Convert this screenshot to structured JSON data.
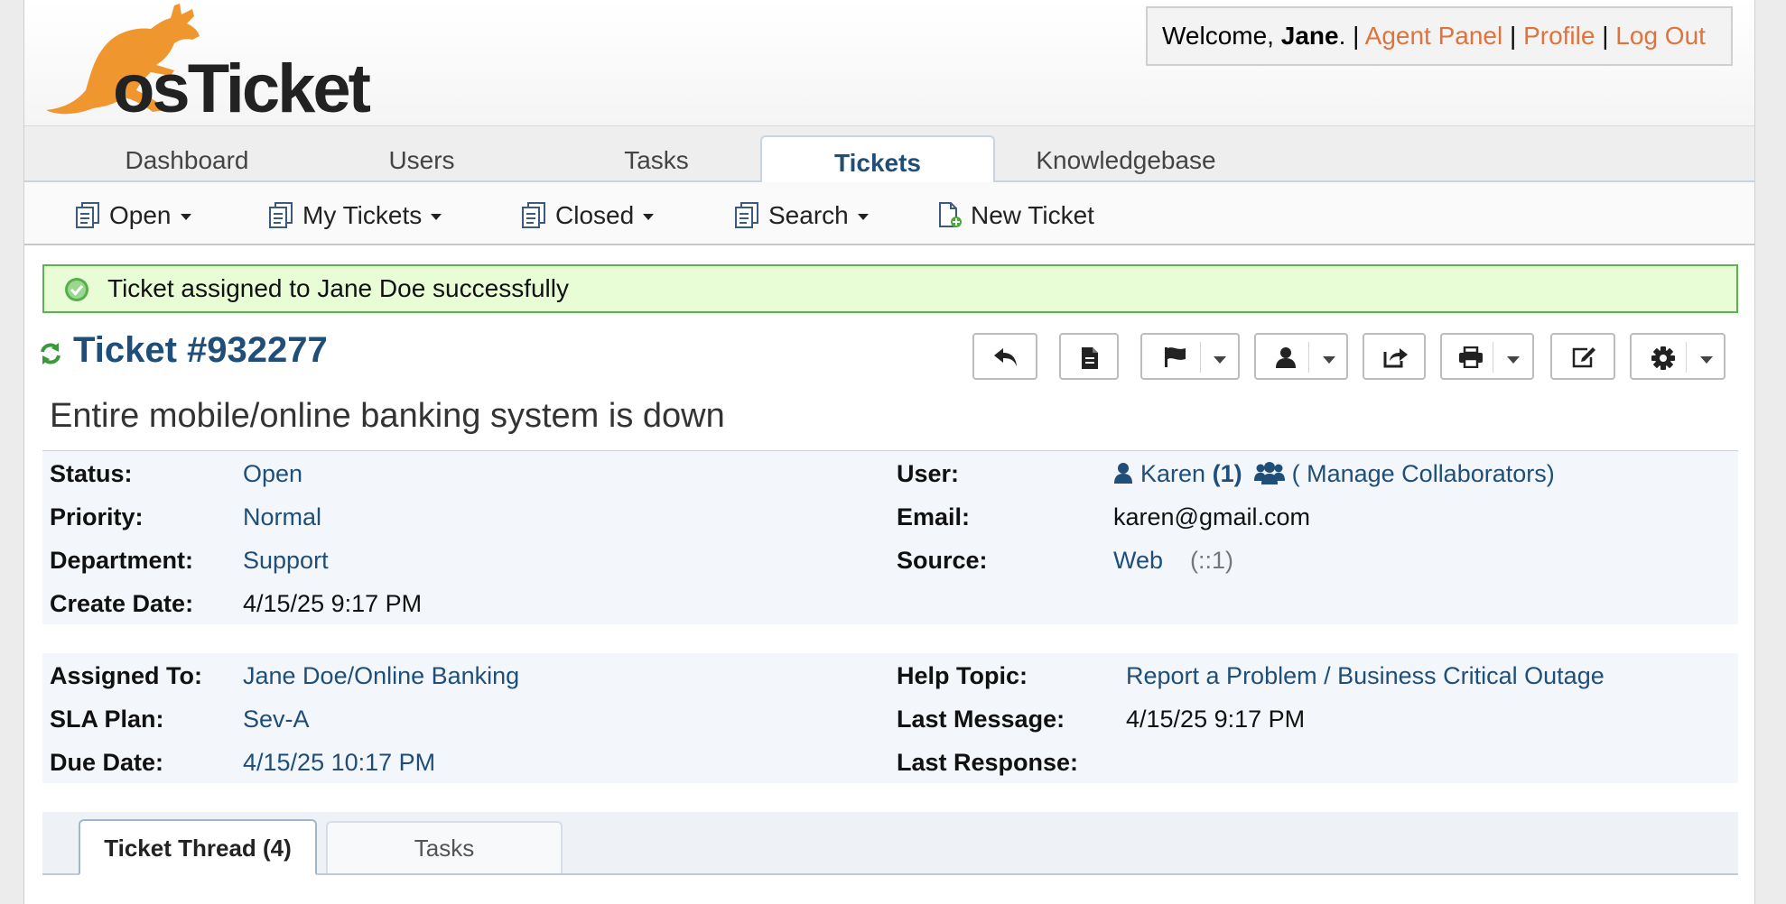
{
  "header": {
    "logo_text": "osTicket",
    "welcome_prefix": "Welcome, ",
    "user_name": "Jane",
    "welcome_suffix": ". | ",
    "agent_panel": "Agent Panel",
    "profile": "Profile",
    "logout": "Log Out",
    "sep": " | "
  },
  "nav": {
    "tabs": [
      {
        "label": "Dashboard"
      },
      {
        "label": "Users"
      },
      {
        "label": "Tasks"
      },
      {
        "label": "Tickets",
        "active": true
      },
      {
        "label": "Knowledgebase"
      }
    ]
  },
  "subnav": {
    "items": [
      {
        "label": "Open",
        "icon": "tickets-icon",
        "dropdown": true
      },
      {
        "label": "My Tickets",
        "icon": "tickets-icon",
        "dropdown": true
      },
      {
        "label": "Closed",
        "icon": "tickets-icon",
        "dropdown": true
      },
      {
        "label": "Search",
        "icon": "tickets-icon",
        "dropdown": true
      },
      {
        "label": "New Ticket",
        "icon": "new-ticket-icon",
        "dropdown": false
      }
    ]
  },
  "alert": {
    "message": "Ticket assigned to Jane Doe successfully",
    "icon": "success-check-icon"
  },
  "ticket": {
    "title": "Ticket #932277",
    "subject": "Entire mobile/online banking system is down",
    "toolbar": [
      "reply-icon",
      "note-icon",
      "flag-icon",
      "assign-user-icon",
      "transfer-icon",
      "print-icon",
      "edit-icon",
      "gear-icon"
    ]
  },
  "info": {
    "status_label": "Status:",
    "status": "Open",
    "priority_label": "Priority:",
    "priority": "Normal",
    "department_label": "Department:",
    "department": "Support",
    "create_date_label": "Create Date:",
    "create_date": "4/15/25 9:17 PM",
    "user_label": "User:",
    "user_name": "Karen",
    "user_count": "(1)",
    "collaborators": "( Manage Collaborators)",
    "email_label": "Email:",
    "email": "karen@gmail.com",
    "source_label": "Source:",
    "source": "Web",
    "source_ip": "(::1)"
  },
  "assignment": {
    "assigned_to_label": "Assigned To:",
    "assigned_to": "Jane Doe/Online Banking",
    "sla_label": "SLA Plan:",
    "sla": "Sev-A",
    "due_date_label": "Due Date:",
    "due_date": "4/15/25 10:17 PM",
    "help_topic_label": "Help Topic:",
    "help_topic": "Report a Problem / Business Critical Outage",
    "last_message_label": "Last Message:",
    "last_message": "4/15/25 9:17 PM",
    "last_response_label": "Last Response:",
    "last_response": ""
  },
  "thread_tabs": [
    {
      "label": "Ticket Thread (4)",
      "active": true
    },
    {
      "label": "Tasks",
      "active": false
    }
  ],
  "colors": {
    "accent_link": "#e0733b",
    "primary_blue": "#1f4e78",
    "success_bg": "#e8fdd6",
    "success_border": "#5ab44e",
    "logo_orange": "#f0962e"
  }
}
